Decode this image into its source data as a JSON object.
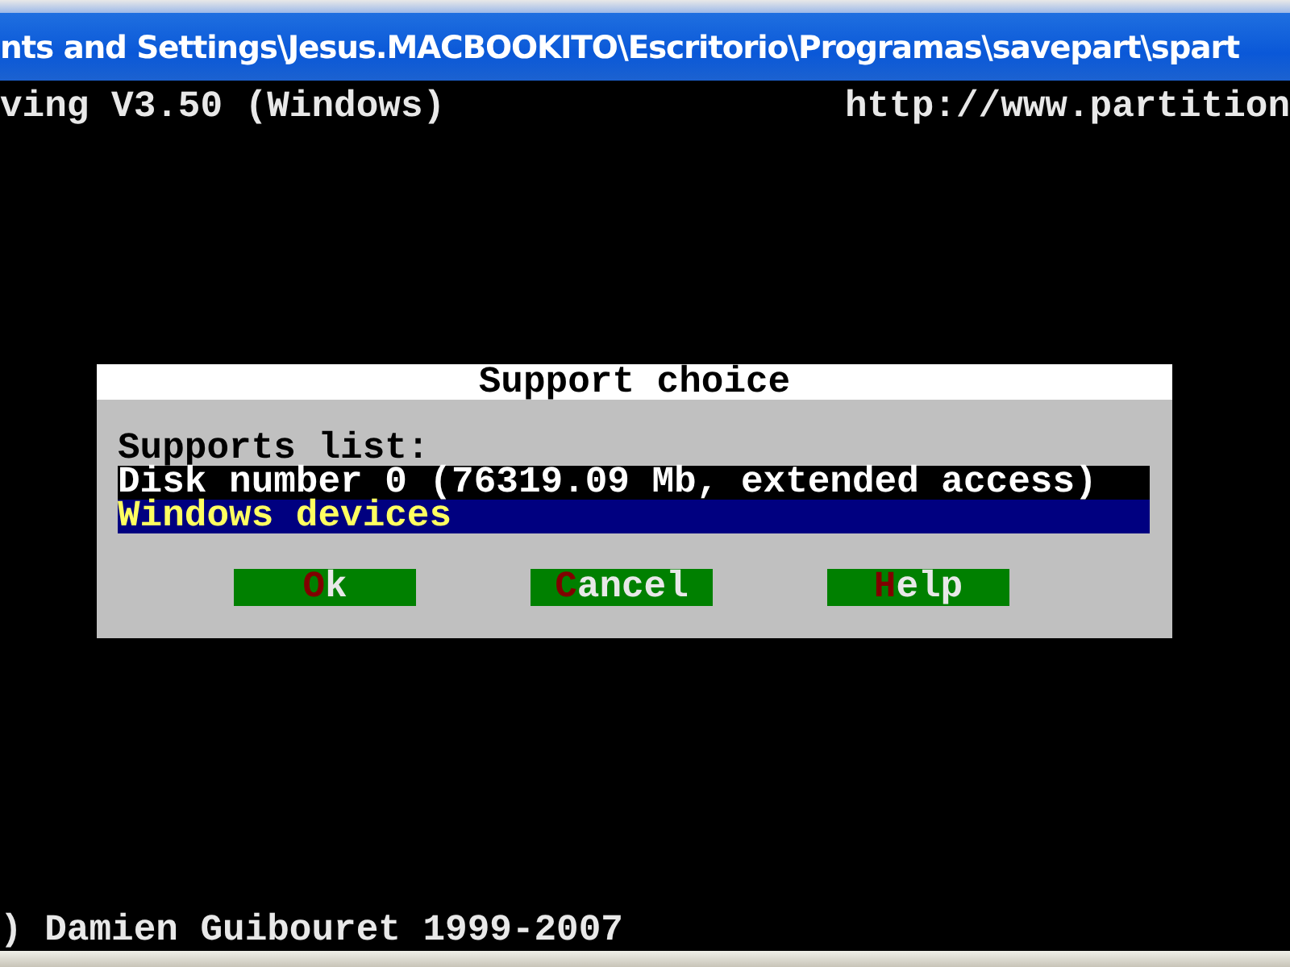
{
  "window": {
    "title": "nts and Settings\\Jesus.MACBOOKITO\\Escritorio\\Programas\\savepart\\spart"
  },
  "console": {
    "header_left": "ving V3.50 (Windows)",
    "header_right": "http://www.partition",
    "footer": ") Damien Guibouret 1999-2007"
  },
  "dialog": {
    "title": "Support choice",
    "list_label": "Supports list:",
    "items": [
      {
        "label": "Disk number 0 (76319.09 Mb, extended access)",
        "selected": false
      },
      {
        "label": "Windows devices",
        "selected": true
      }
    ],
    "buttons": [
      {
        "hotkey": "O",
        "label": "k"
      },
      {
        "hotkey": "C",
        "label": "ancel"
      },
      {
        "hotkey": "H",
        "label": "elp"
      }
    ]
  }
}
